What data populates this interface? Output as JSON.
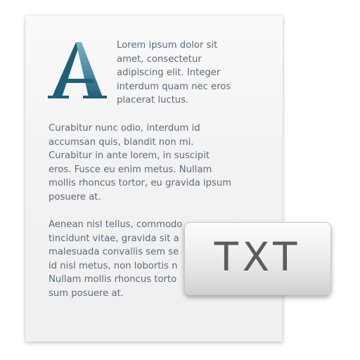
{
  "document": {
    "dropcap_letter": "A",
    "paragraph1": "Lorem ipsum dolor sit\namet, consectetur\nadipiscing elit. Integer\ninterdum quam nec eros\nplacerat luctus.",
    "paragraph2": "Curabitur nunc odio, interdum id\naccumsan quis, blandit non mi.\nCurabitur in ante lorem, in suscipit\neros. Fusce eu enim metus. Nullam\nmollis rhoncus tortor, eu gravida ipsum\nposuere at.",
    "paragraph3": "Aenean nisl tellus, commodo\ntincidunt vitae, gravida sit a\nmalesuada convallis sem se\nid nisl metus, non lobortis n\nNullam mollis rhoncus torto\nsum posuere at."
  },
  "badge": {
    "label": "TXT"
  },
  "colors": {
    "dropcap_dark": "#1f5f78",
    "dropcap_light": "#7fb0c2",
    "text": "#5b6b7a",
    "badge_text": "#5c5c5c"
  }
}
